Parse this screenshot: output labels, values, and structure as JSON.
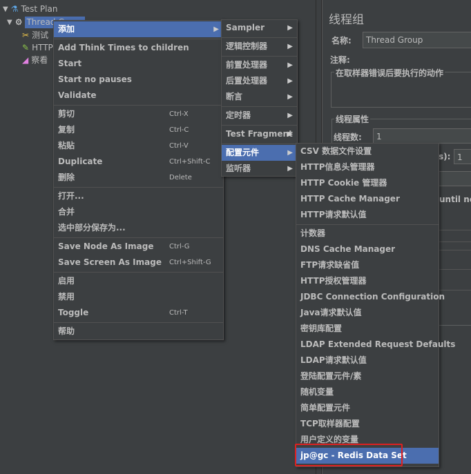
{
  "tree": {
    "nodes": [
      {
        "label": "Test Plan",
        "icon": "flask-icon"
      },
      {
        "label": "Thread Group",
        "icon": "gear-icon"
      },
      {
        "label": "测试",
        "icon": "tools-icon"
      },
      {
        "label": "HTTP",
        "icon": "pipette-icon"
      },
      {
        "label": "察看",
        "icon": "graph-icon"
      }
    ]
  },
  "panel": {
    "title": "线程组",
    "name_label": "名称:",
    "name_value": "Thread Group",
    "comment_label": "注释:",
    "on_error_label": "在取样器错误后要执行的动作",
    "thread_props_label": "线程属性",
    "threads_label": "线程数:",
    "threads_value": "1",
    "rampup_label": "s):",
    "rampup_value": "1",
    "until_text": "until nee"
  },
  "menu1": [
    {
      "label": "添加",
      "arrow": true,
      "highlighted": true
    },
    {
      "sep": true
    },
    {
      "label": "Add Think Times to children"
    },
    {
      "label": "Start"
    },
    {
      "label": "Start no pauses"
    },
    {
      "label": "Validate"
    },
    {
      "sep": true
    },
    {
      "label": "剪切",
      "shortcut": "Ctrl-X"
    },
    {
      "label": "复制",
      "shortcut": "Ctrl-C"
    },
    {
      "label": "粘贴",
      "shortcut": "Ctrl-V"
    },
    {
      "label": "Duplicate",
      "shortcut": "Ctrl+Shift-C"
    },
    {
      "label": "删除",
      "shortcut": "Delete"
    },
    {
      "sep": true
    },
    {
      "label": "打开..."
    },
    {
      "label": "合并"
    },
    {
      "label": "选中部分保存为..."
    },
    {
      "sep": true
    },
    {
      "label": "Save Node As Image",
      "shortcut": "Ctrl-G"
    },
    {
      "label": "Save Screen As Image",
      "shortcut": "Ctrl+Shift-G"
    },
    {
      "sep": true
    },
    {
      "label": "启用"
    },
    {
      "label": "禁用"
    },
    {
      "label": "Toggle",
      "shortcut": "Ctrl-T"
    },
    {
      "sep": true
    },
    {
      "label": "帮助"
    }
  ],
  "menu2": [
    {
      "label": "Sampler",
      "arrow": true
    },
    {
      "sep": true
    },
    {
      "label": "逻辑控制器",
      "arrow": true
    },
    {
      "sep": true
    },
    {
      "label": "前置处理器",
      "arrow": true
    },
    {
      "label": "后置处理器",
      "arrow": true
    },
    {
      "label": "断言",
      "arrow": true
    },
    {
      "sep": true
    },
    {
      "label": "定时器",
      "arrow": true
    },
    {
      "sep": true
    },
    {
      "label": "Test Fragment",
      "arrow": true
    },
    {
      "sep": true
    },
    {
      "label": "配置元件",
      "arrow": true,
      "highlighted": true
    },
    {
      "label": "监听器",
      "arrow": true
    }
  ],
  "menu3": [
    {
      "label": "CSV 数据文件设置"
    },
    {
      "label": "HTTP信息头管理器"
    },
    {
      "label": "HTTP Cookie 管理器"
    },
    {
      "label": "HTTP Cache Manager"
    },
    {
      "label": "HTTP请求默认值"
    },
    {
      "sep": true
    },
    {
      "label": "计数器"
    },
    {
      "label": "DNS Cache Manager"
    },
    {
      "label": "FTP请求缺省值"
    },
    {
      "label": "HTTP授权管理器"
    },
    {
      "label": "JDBC Connection Configuration"
    },
    {
      "label": "Java请求默认值"
    },
    {
      "label": "密钥库配置"
    },
    {
      "label": "LDAP Extended Request Defaults"
    },
    {
      "label": "LDAP请求默认值"
    },
    {
      "label": "登陆配置元件/素"
    },
    {
      "label": "随机变量"
    },
    {
      "label": "简单配置元件"
    },
    {
      "label": "TCP取样器配置"
    },
    {
      "label": "用户定义的变量"
    },
    {
      "label": "jp@gc - Redis Data Set",
      "highlighted": true
    }
  ],
  "colors": {
    "highlight": "#4b6eaf",
    "annotation": "#e02020",
    "background": "#3c3f41"
  }
}
